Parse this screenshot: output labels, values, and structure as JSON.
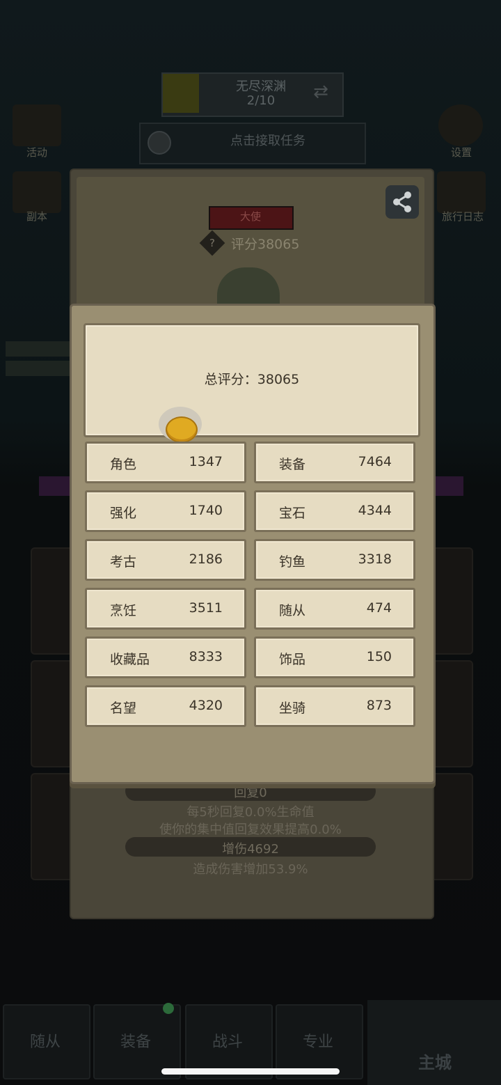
{
  "background": {
    "stage": {
      "title": "无尽深渊",
      "progress": "2/10"
    },
    "quest": {
      "text": "点击接取任务"
    },
    "side_left": [
      "活动",
      "副本"
    ],
    "side_right": [
      "设置",
      "旅行日志"
    ],
    "nav": [
      "随从",
      "装备",
      "战斗",
      "专业"
    ],
    "home": "主城"
  },
  "under_panel": {
    "title_badge": "大使",
    "score_label": "评分38065",
    "question_mark": "?",
    "stats": {
      "recover_pill": "回复0",
      "recover_line1": "每5秒回复0.0%生命值",
      "recover_line2": "使你的集中值回复效果提高0.0%",
      "damage_pill": "增伤4692",
      "damage_line": "造成伤害增加53.9%"
    }
  },
  "popup": {
    "total_label": "总评分：38065",
    "scores": [
      {
        "label": "角色",
        "value": "1347"
      },
      {
        "label": "装备",
        "value": "7464"
      },
      {
        "label": "强化",
        "value": "1740"
      },
      {
        "label": "宝石",
        "value": "4344"
      },
      {
        "label": "考古",
        "value": "2186"
      },
      {
        "label": "钓鱼",
        "value": "3318"
      },
      {
        "label": "烹饪",
        "value": "3511"
      },
      {
        "label": "随从",
        "value": "474"
      },
      {
        "label": "收藏品",
        "value": "8333"
      },
      {
        "label": "饰品",
        "value": "150"
      },
      {
        "label": "名望",
        "value": "4320"
      },
      {
        "label": "坐骑",
        "value": "873"
      }
    ]
  },
  "colors": {
    "popup_bg": "#9a8f72",
    "parchment": "#e6dcc2",
    "text_dark": "#3a3328",
    "coin": "#e0aa22"
  },
  "icons": [
    "share-icon",
    "coin-icon",
    "question-icon",
    "swap-icon"
  ]
}
